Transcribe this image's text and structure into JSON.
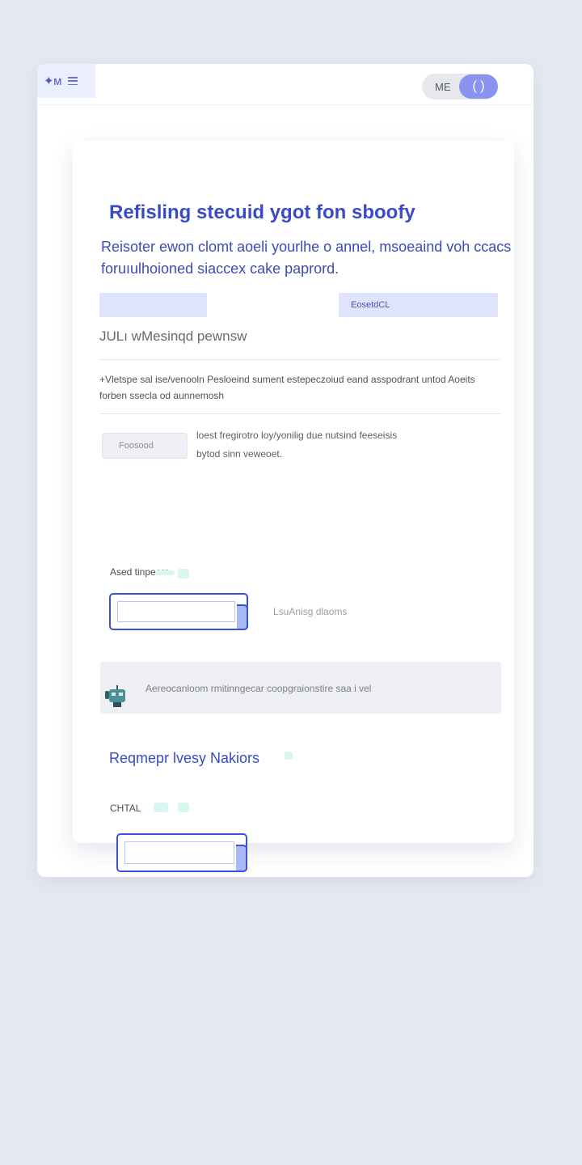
{
  "header": {
    "brand": "✦ᴍ",
    "toggle_label": "ME",
    "toggle_knob_symbol": "( )"
  },
  "card": {
    "title": "Refisling stecuid  ygot fon sboofy",
    "lead": "Reisoter ewon clomt aoeli  yourlhe o annel, msoeaind voh ccacs foruıulhoioned siaccex cake paprord.",
    "left_button_label": "",
    "right_button_label": "EosetdCL",
    "subtitle": "JULı wMesinqd pewnsw",
    "description": "+Vletspe sal ise/venooln Pesloeind sument  estepeczoiud eand asspodrant untod Aoeits forben ssecla od aunnemosh",
    "small_input_value": "Foosood",
    "hint": "loest fregirotro loy/yonilig due nutsind feeseisis bytod sinn veweoet.",
    "field1_label": "Ased tinpeers",
    "aside_text": "LsuAnisg dlaoms",
    "banner_text": "Aereocanloom rmitinngecar coopgraionstire saa i vel",
    "section2_title": "Reqmepr lvesy Nakiors",
    "field2_label": "CHTAL"
  },
  "colors": {
    "accent": "#3a4bc8",
    "button_fill": "#dfe3fc",
    "toggle_knob": "#8b93ef",
    "mint_decoration": "#d7f6ef"
  },
  "icons": {
    "menu": "menu-icon",
    "robot": "robot-icon"
  }
}
